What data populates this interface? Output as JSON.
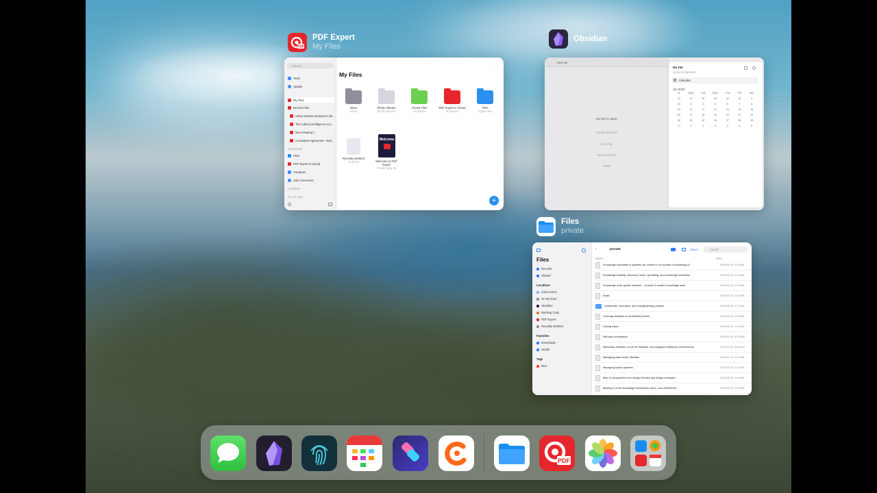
{
  "switcher": {
    "pdf_expert": {
      "title": "PDF Expert",
      "subtitle": "My Files",
      "window": {
        "search": "Search",
        "sidebar": [
          "Tools",
          "Update",
          "My Files",
          "Recent Files",
          "Using network analysis to ide...",
          "The cultural intelligence eco...",
          "New Drawing 1",
          "Consultant Agreement - Busi...",
          "Cloud tools",
          "Files",
          "PDF Expert in iCloud",
          "Computer",
          "Add Connection",
          "Locations",
          "Go into app"
        ],
        "heading": "My Files",
        "folders": [
          {
            "name": "Inbox",
            "meta": "Inbox"
          },
          {
            "name": "iPhoto Albums",
            "meta": "iPhoto Albums"
          },
          {
            "name": "iTunes Files",
            "meta": "on device"
          },
          {
            "name": "PDF Expert in iCloud",
            "meta": "on device"
          },
          {
            "name": "Files",
            "meta": "Apple Files"
          },
          {
            "name": "Recently Deleted",
            "meta": "no items"
          },
          {
            "name": "Welcome to PDF Expert",
            "meta": "Create, May 26"
          }
        ],
        "cover_text": "Welcome"
      }
    },
    "obsidian": {
      "title": "Obsidian",
      "window": {
        "new_tab": "New tab",
        "no_file": "No file is open",
        "actions": [
          "Create new note",
          "Go to file",
          "See recent files",
          "Close"
        ],
        "panel_title": "No file",
        "panel_sub": "Jump to Calendar",
        "calendar_tab": "Calendar",
        "month": "Jun 2024",
        "weekdays": [
          "W",
          "MON",
          "TUE",
          "WED",
          "THU",
          "FRI",
          "SAT"
        ],
        "days": [
          "22",
          "27",
          "28",
          "29",
          "30",
          "31",
          "1",
          "23",
          "3",
          "4",
          "5",
          "6",
          "7",
          "8",
          "24",
          "10",
          "11",
          "12",
          "13",
          "14",
          "15",
          "25",
          "17",
          "18",
          "19",
          "20",
          "21",
          "22",
          "26",
          "24",
          "25",
          "26",
          "27",
          "28",
          "29",
          "27",
          "1",
          "2",
          "3",
          "4",
          "5",
          "6"
        ]
      }
    },
    "files": {
      "title": "Files",
      "subtitle": "private",
      "window": {
        "app_title": "Files",
        "sidebar": {
          "items_top": [
            "Recents",
            "Shared"
          ],
          "locations_label": "Locations",
          "locations": [
            "iCloud Drive",
            "On My iPad",
            "Obsidian",
            "Working Copy",
            "PDF Expert",
            "Recently Deleted"
          ],
          "favorites_label": "Favorites",
          "favorites": [
            "Downloads",
            "Health"
          ],
          "tags_label": "Tags",
          "tags": [
            "Red"
          ]
        },
        "toolbar": {
          "folder": "private",
          "select": "Select",
          "search": "Search"
        },
        "columns": [
          "Name",
          "Date"
        ],
        "rows": [
          {
            "name": "Knowledge innovation in systemic art: invited in our models of publishing v2",
            "date": "2024-05-15, 11:46 AM"
          },
          {
            "name": "Knowledge building, discovery, reach, spreading, and knowledge innovation",
            "date": "2024-05-15, 11:43 AM"
          },
          {
            "name": "Knowledge work opinion software ...to solve in modern knowledge work",
            "date": "2024-05-15, 11:43 AM"
          },
          {
            "name": "Notes",
            "date": "2024-05-15, 11:43 AM"
          },
          {
            "name": "Leadership, innovation, and change/driving practice",
            "date": "2024-05-15, 11:12 AM"
          },
          {
            "name": "Leverage analysis on productivity issues",
            "date": "2024-05-15, 11:06 AM"
          },
          {
            "name": "Linking notes",
            "date": "2024-05-15, 11:11 AM"
          },
          {
            "name": "Mat topic comparison",
            "date": "2024-05-16, 10:18 AM"
          },
          {
            "name": "Markdown rewritten, a hub for Obsidian, and integrated fieldwork environments",
            "date": "2024-05-04, 10:44 AM"
          },
          {
            "name": "Managing state inside Obsidian",
            "date": "2024-05-15, 11:17 AM"
          },
          {
            "name": "Managing Notion systems",
            "date": "2024-05-15, 11:10 AM"
          },
          {
            "name": "Map of components from design theories and design principles",
            "date": "2024-05-15, 11:06 AM"
          },
          {
            "name": "Meeting 3 of the knowledge Architecture issue, Lulu 2024/06/06",
            "date": "2024-05-15, 11:08 AM"
          }
        ]
      }
    }
  },
  "dock": {
    "apps": [
      "messages-app",
      "obsidian-app",
      "fingerprint-app",
      "fantastical-app",
      "shortcuts-app",
      "craft-app",
      "files-app",
      "pdf-expert-app",
      "photos-app",
      "app-library"
    ],
    "pdf_label": "PDF"
  },
  "colors": {
    "pdf_red": "#e5262c",
    "obsidian_purple": "#7c4dde",
    "files_blue": "#1a8cf0",
    "messages_green": "#3fcd4f",
    "shortcuts": "#4a3cc9",
    "craft_orange": "#ff6a1a"
  }
}
